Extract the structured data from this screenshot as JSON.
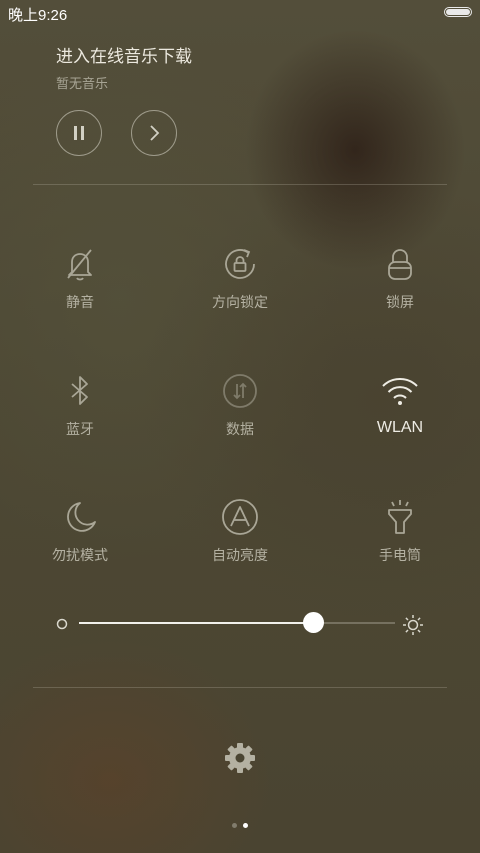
{
  "status_bar": {
    "time": "晚上9:26",
    "battery_icon": "battery-icon"
  },
  "music": {
    "title": "进入在线音乐下载",
    "subtitle": "暂无音乐",
    "pause_icon": "pause-icon",
    "next_icon": "chevron-right-icon"
  },
  "toggles": [
    {
      "label": "静音",
      "icon": "bell-off-icon",
      "active": false
    },
    {
      "label": "方向锁定",
      "icon": "rotation-lock-icon",
      "active": false
    },
    {
      "label": "锁屏",
      "icon": "lock-icon",
      "active": false
    },
    {
      "label": "蓝牙",
      "icon": "bluetooth-icon",
      "active": false
    },
    {
      "label": "数据",
      "icon": "mobile-data-icon",
      "active": false
    },
    {
      "label": "WLAN",
      "icon": "wifi-icon",
      "active": true
    },
    {
      "label": "勿扰模式",
      "icon": "moon-icon",
      "active": false
    },
    {
      "label": "自动亮度",
      "icon": "auto-brightness-icon",
      "active": false
    },
    {
      "label": "手电筒",
      "icon": "flashlight-icon",
      "active": false
    }
  ],
  "brightness": {
    "level": 0.74,
    "low_icon": "brightness-low-icon",
    "high_icon": "brightness-high-icon"
  },
  "settings": {
    "icon": "gear-icon"
  },
  "pager": {
    "pages": 2,
    "current": 2
  },
  "colors": {
    "accent_on": "#eeece4",
    "icon_off": "#a9a696",
    "background": "#4a4532"
  }
}
